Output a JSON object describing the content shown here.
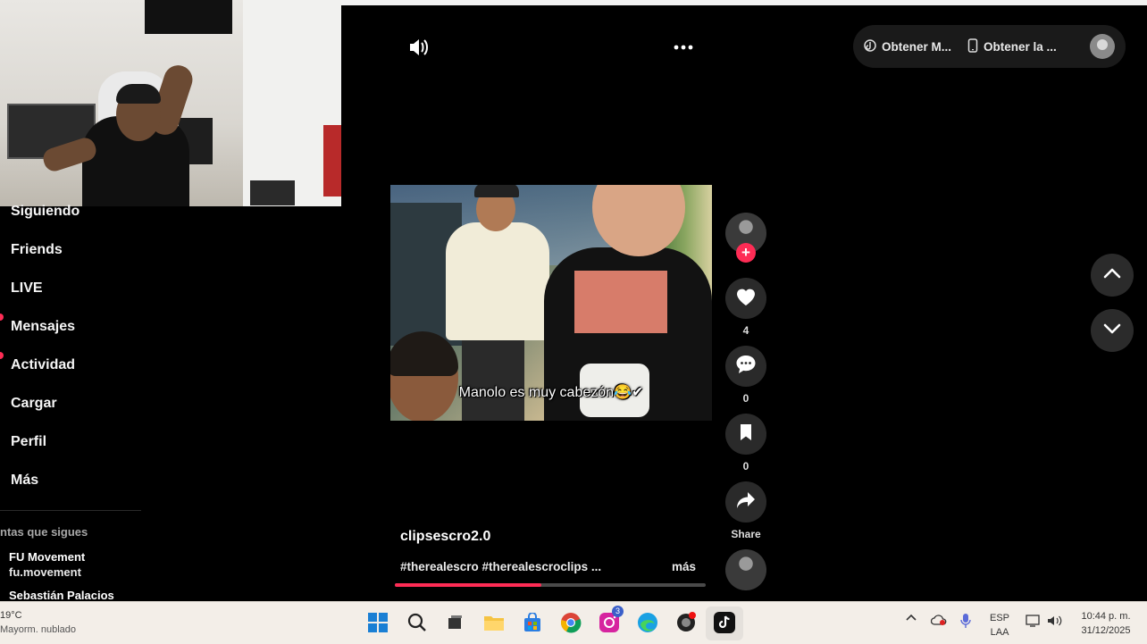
{
  "sidebar": {
    "items": [
      {
        "label": "Siguiendo"
      },
      {
        "label": "Friends"
      },
      {
        "label": "LIVE"
      },
      {
        "label": "Mensajes"
      },
      {
        "label": "Actividad"
      },
      {
        "label": "Cargar"
      },
      {
        "label": "Perfil"
      },
      {
        "label": "Más"
      }
    ],
    "following_header": "ntas que sigues",
    "accounts": [
      {
        "name": "FU Movement",
        "username": "fu.movement"
      },
      {
        "name": "Sebastián Palacios"
      }
    ]
  },
  "topbar": {
    "volume_icon": "volume-icon",
    "more_icon": "more-horizontal-icon",
    "get_coins_label": "Obtener M...",
    "get_app_label": "Obtener la ..."
  },
  "video": {
    "caption_overlay": "Manolo es muy cabezón😂✔",
    "author": "clipsescro2.0",
    "hashtags": "#therealescro #therealescroclips ...",
    "more_label": "más",
    "progress": 0.47
  },
  "actions": {
    "likes": "4",
    "comments": "0",
    "saves": "0",
    "share_label": "Share"
  },
  "colors": {
    "accent": "#fe2c55",
    "background": "#000000",
    "taskbar": "#f3eee8"
  },
  "taskbar": {
    "weather_temp": "19°C",
    "weather_desc": "Mayorm. nublado",
    "instagram_badge": "3",
    "language_top": "ESP",
    "language_bottom": "LAA",
    "time": "10:44 p. m.",
    "date": "31/12/2025"
  }
}
